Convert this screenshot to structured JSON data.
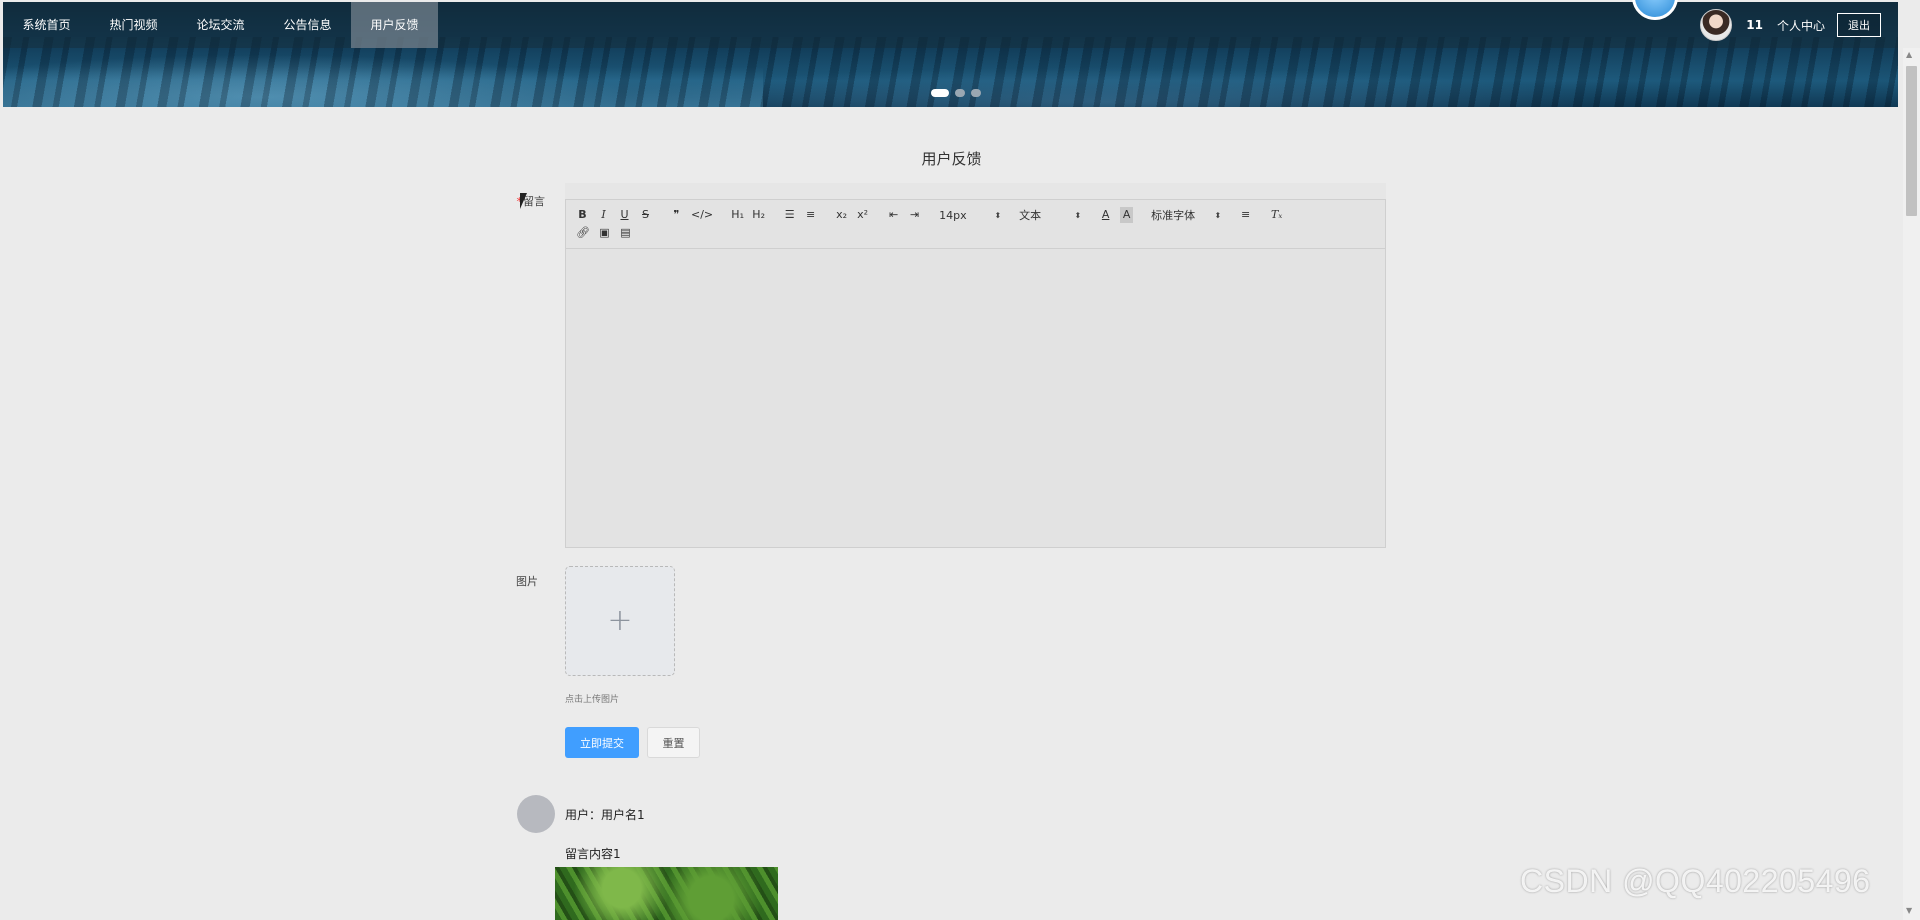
{
  "nav": {
    "items": [
      {
        "label": "系统首页",
        "active": false
      },
      {
        "label": "热门视频",
        "active": false
      },
      {
        "label": "论坛交流",
        "active": false
      },
      {
        "label": "公告信息",
        "active": false
      },
      {
        "label": "用户反馈",
        "active": true
      }
    ],
    "username": "11",
    "profile_label": "个人中心",
    "logout_label": "退出"
  },
  "banner": {
    "slides_total": 3,
    "active_slide": 1
  },
  "form": {
    "title": "用户反馈",
    "message_label": "留言",
    "required_mark": "*",
    "image_label": "图片",
    "upload_tip": "点击上传图片",
    "submit_label": "立即提交",
    "reset_label": "重置",
    "editor": {
      "font_size": "14px",
      "paragraph": "文本",
      "font_family": "标准字体"
    }
  },
  "comments": [
    {
      "user_line": "用户：用户名1",
      "content": "留言内容1"
    }
  ],
  "watermark": "CSDN @QQ402205496",
  "colors": {
    "primary": "#409eff",
    "page_bg": "#ebebeb",
    "required": "#ee3333"
  }
}
